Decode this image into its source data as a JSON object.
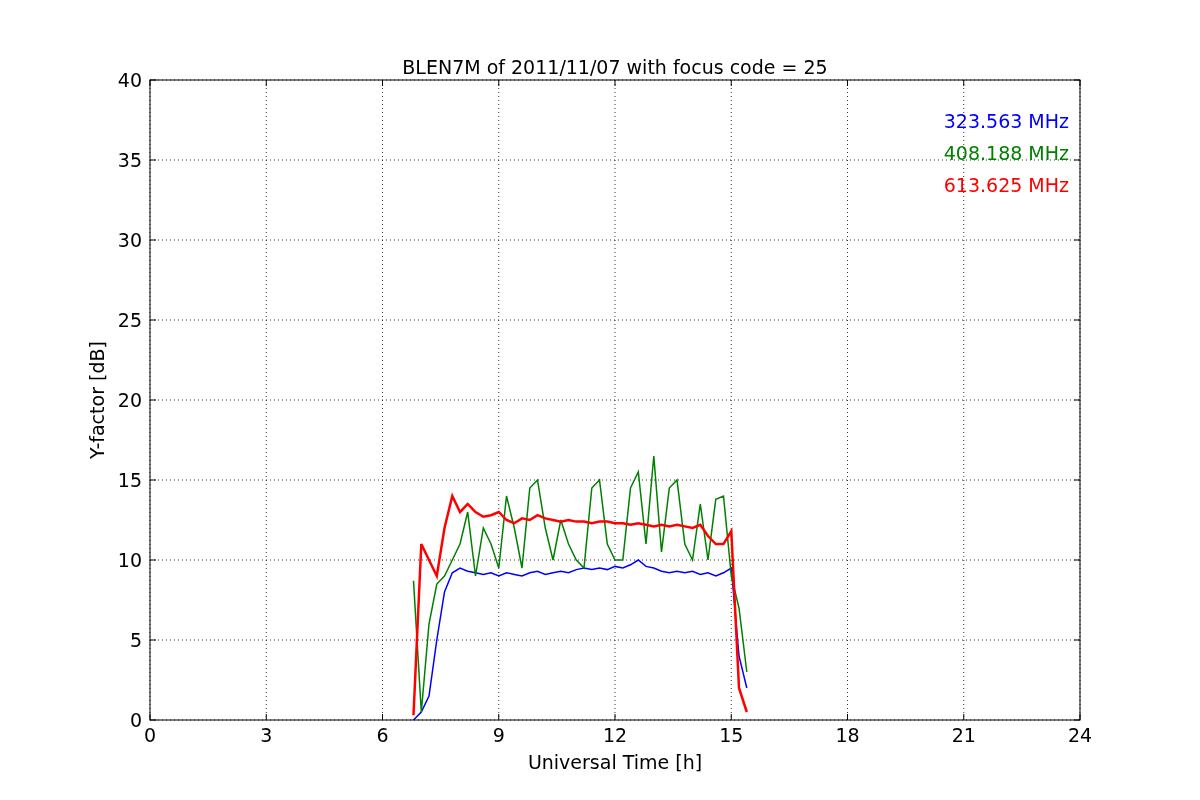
{
  "chart_data": {
    "type": "line",
    "title": "BLEN7M of 2011/11/07 with focus code = 25",
    "xlabel": "Universal Time [h]",
    "ylabel": "Y-factor [dB]",
    "x": [
      6.8,
      7.0,
      7.2,
      7.4,
      7.6,
      7.8,
      8.0,
      8.2,
      8.4,
      8.6,
      8.8,
      9.0,
      9.2,
      9.4,
      9.6,
      9.8,
      10.0,
      10.2,
      10.4,
      10.6,
      10.8,
      11.0,
      11.2,
      11.4,
      11.6,
      11.8,
      12.0,
      12.2,
      12.4,
      12.6,
      12.8,
      13.0,
      13.2,
      13.4,
      13.6,
      13.8,
      14.0,
      14.2,
      14.4,
      14.6,
      14.8,
      15.0,
      15.2,
      15.4
    ],
    "series": [
      {
        "name": "323.563 MHz",
        "color": "#0000ff",
        "values": [
          0,
          0.5,
          1.5,
          5,
          8,
          9.2,
          9.5,
          9.3,
          9.2,
          9.1,
          9.2,
          9.0,
          9.2,
          9.1,
          9.0,
          9.2,
          9.3,
          9.1,
          9.2,
          9.3,
          9.2,
          9.4,
          9.5,
          9.4,
          9.5,
          9.4,
          9.6,
          9.5,
          9.7,
          10,
          9.6,
          9.5,
          9.3,
          9.2,
          9.3,
          9.2,
          9.3,
          9.1,
          9.2,
          9.0,
          9.2,
          9.5,
          4,
          2
        ]
      },
      {
        "name": "408.188 MHz",
        "color": "#008000",
        "values": [
          8.7,
          0.5,
          6,
          8.5,
          9,
          10,
          11,
          13,
          9,
          12,
          11,
          9.5,
          14,
          12,
          9.5,
          14.5,
          15,
          12,
          10,
          12.5,
          11,
          10,
          9.5,
          14.5,
          15,
          11,
          10,
          10,
          14.5,
          15.5,
          11,
          16.5,
          10.5,
          14.5,
          15,
          11,
          10,
          13.5,
          10,
          13.8,
          14,
          9,
          7,
          3
        ]
      },
      {
        "name": "613.625 MHz",
        "color": "#ff0000",
        "values": [
          0.3,
          11,
          10,
          9,
          12,
          14,
          13,
          13.5,
          13,
          12.7,
          12.8,
          13,
          12.5,
          12.3,
          12.6,
          12.5,
          12.8,
          12.6,
          12.5,
          12.4,
          12.5,
          12.4,
          12.4,
          12.3,
          12.4,
          12.4,
          12.3,
          12.3,
          12.2,
          12.3,
          12.2,
          12.1,
          12.2,
          12.1,
          12.2,
          12.1,
          12,
          12.2,
          11.5,
          11,
          11,
          11.8,
          2,
          0.5
        ]
      }
    ],
    "grid": true,
    "xlim": [
      0,
      24
    ],
    "ylim": [
      0,
      40
    ],
    "xticks": [
      0,
      3,
      6,
      9,
      12,
      15,
      18,
      21,
      24
    ],
    "yticks": [
      0,
      5,
      10,
      15,
      20,
      25,
      30,
      35,
      40
    ]
  }
}
